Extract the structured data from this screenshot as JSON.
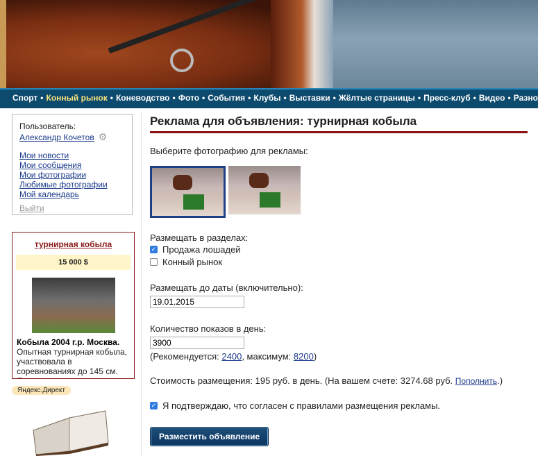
{
  "nav": {
    "items": [
      {
        "label": "Спорт",
        "active": false
      },
      {
        "label": "Конный рынок",
        "active": true
      },
      {
        "label": "Коневодство",
        "active": false
      },
      {
        "label": "Фото",
        "active": false
      },
      {
        "label": "События",
        "active": false
      },
      {
        "label": "Клубы",
        "active": false
      },
      {
        "label": "Выставки",
        "active": false
      },
      {
        "label": "Жёлтые страницы",
        "active": false
      },
      {
        "label": "Пресс-клуб",
        "active": false
      },
      {
        "label": "Видео",
        "active": false
      },
      {
        "label": "Разное",
        "active": false
      }
    ],
    "separator": "•"
  },
  "user": {
    "label": "Пользователь:",
    "name": "Александр Кочетов",
    "links": [
      "Мои новости",
      "Мои сообщения",
      "Мои фотографии",
      "Любимые фотографии",
      "Мой календарь"
    ],
    "logout": "Выйти"
  },
  "ad": {
    "title": "турнирная кобыла",
    "price": "15 000 $",
    "desc_bold": "Кобыла 2004 г.р. Москва",
    "desc_dot": ".",
    "desc_text": "Опытная турнирная кобыла, участвовала в соревнованиях до 145 см. Прыгает под юношу"
  },
  "direct": "Яндекс.Директ",
  "main": {
    "title": "Реклама для объявления: турнирная кобыла",
    "pick_label": "Выберите фотографию для рекламы:",
    "sections_label": "Размещать в разделах:",
    "sections": [
      {
        "label": "Продажа лошадей",
        "checked": true
      },
      {
        "label": "Конный рынок",
        "checked": false
      }
    ],
    "date_label": "Размещать до даты (включительно):",
    "date_value": "19.01.2015",
    "count_label": "Количество показов в день:",
    "count_value": "3900",
    "rec_prefix": "(Рекомендуется: ",
    "rec_value": "2400",
    "rec_mid": ", максимум: ",
    "max_value": "8200",
    "rec_suffix": ")",
    "cost_text": "Стоимость размещения: 195 руб. в день. (На вашем счете: 3274.68 руб. ",
    "topup": "Пополнить",
    "cost_suffix": ".)",
    "agree": "Я подтверждаю, что согласен с правилами размещения рекламы.",
    "agree_checked": true,
    "submit": "Разместить объявление"
  },
  "colors": {
    "nav_bg": "#0c4a6e",
    "active_nav": "#f6e27a",
    "accent": "#8a1010",
    "link": "#1a3a8c"
  }
}
